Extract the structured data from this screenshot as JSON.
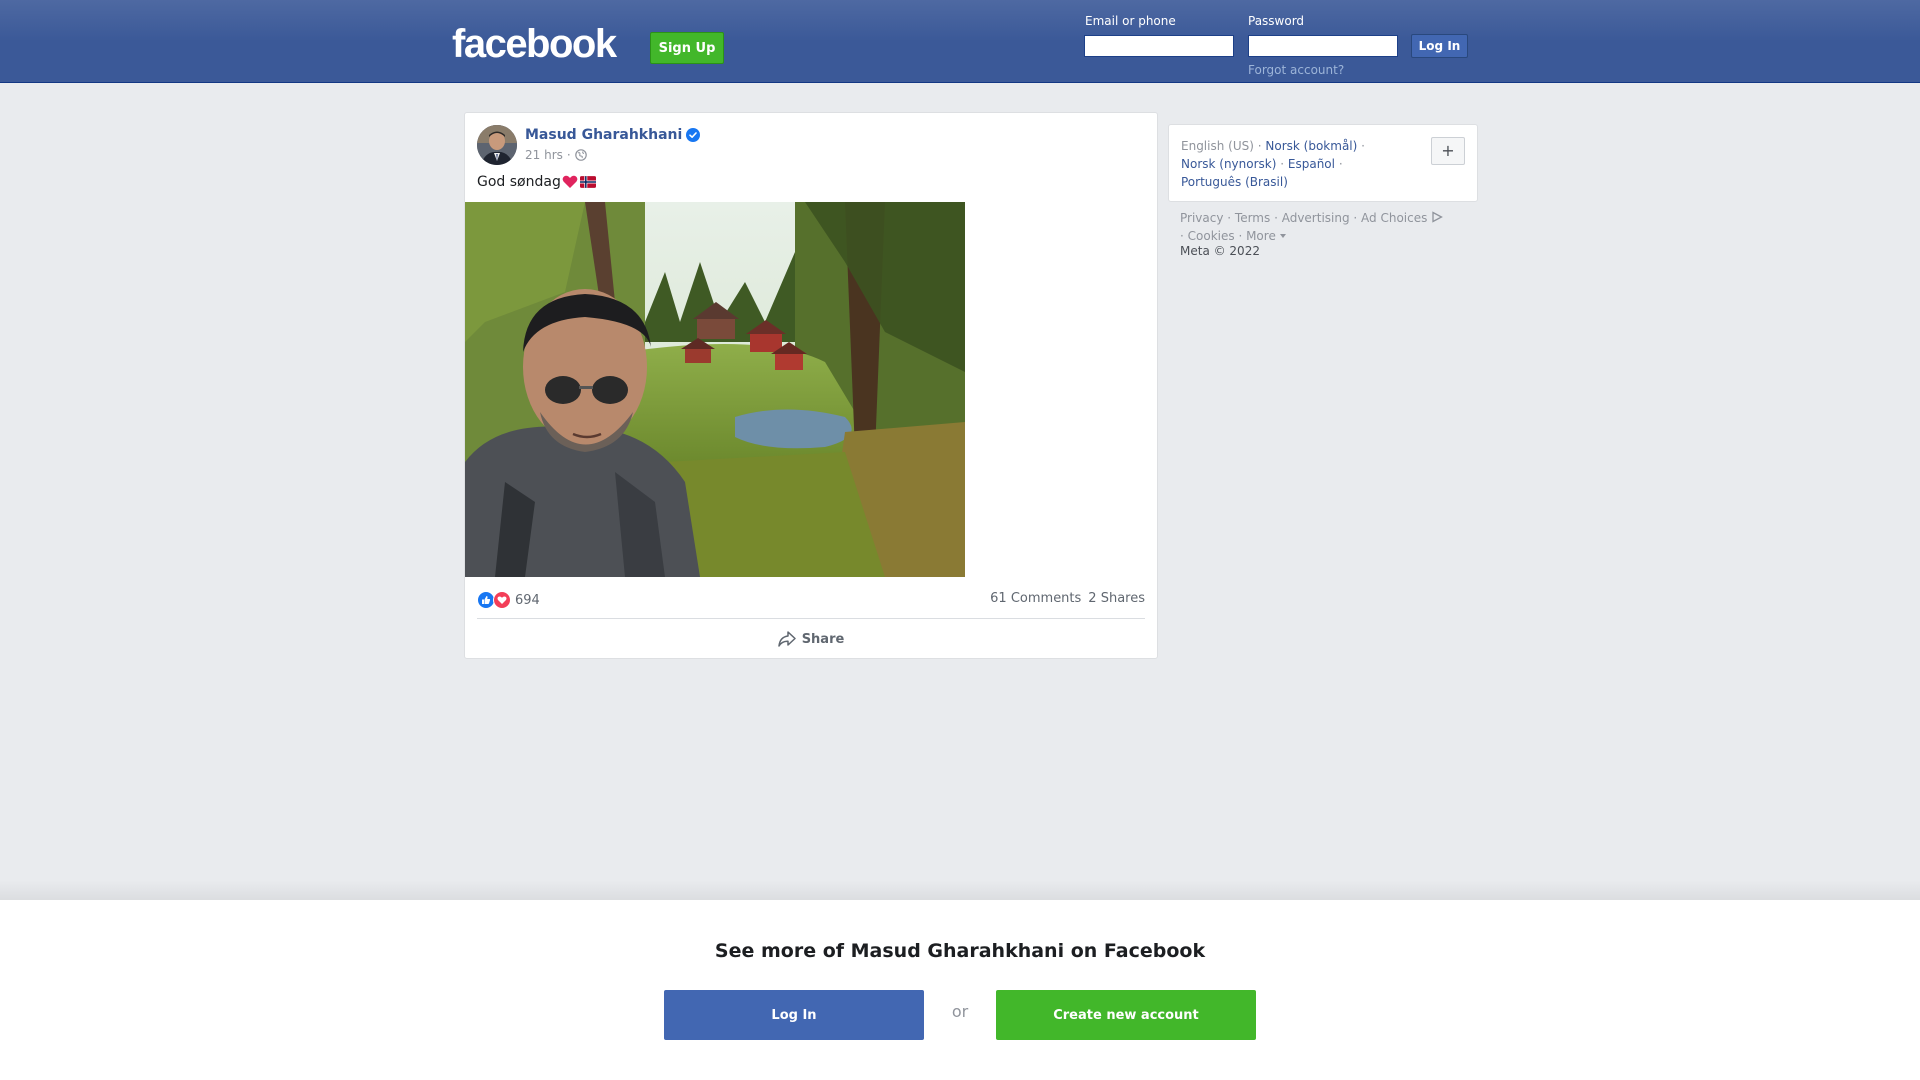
{
  "header": {
    "logo_text": "facebook",
    "signup_label": "Sign Up",
    "email_label": "Email or phone",
    "password_label": "Password",
    "login_label": "Log In",
    "forgot_label": "Forgot account?",
    "email_value": "",
    "password_value": ""
  },
  "post": {
    "author": "Masud Gharahkhani",
    "time": "21 hrs",
    "time_separator": "·",
    "text": "God søndag",
    "reaction_count": "694",
    "comments": "61 Comments",
    "shares": "2 Shares",
    "share_label": "Share"
  },
  "languages": {
    "current": "English (US)",
    "links": [
      "Norsk (bokmål)",
      "Norsk (nynorsk)",
      "Español",
      "Português (Brasil)"
    ],
    "more_button": "+"
  },
  "footer": {
    "links": [
      "Privacy",
      "Terms",
      "Advertising",
      "Ad Choices",
      "Cookies",
      "More"
    ],
    "copyright": "Meta © 2022"
  },
  "bottom_sheet": {
    "title": "See more of Masud Gharahkhani on Facebook",
    "login_label": "Log In",
    "or_label": "or",
    "create_label": "Create new account"
  },
  "colors": {
    "brand_blue": "#3b5998",
    "button_green": "#42b72a",
    "link_blue": "#385898"
  }
}
